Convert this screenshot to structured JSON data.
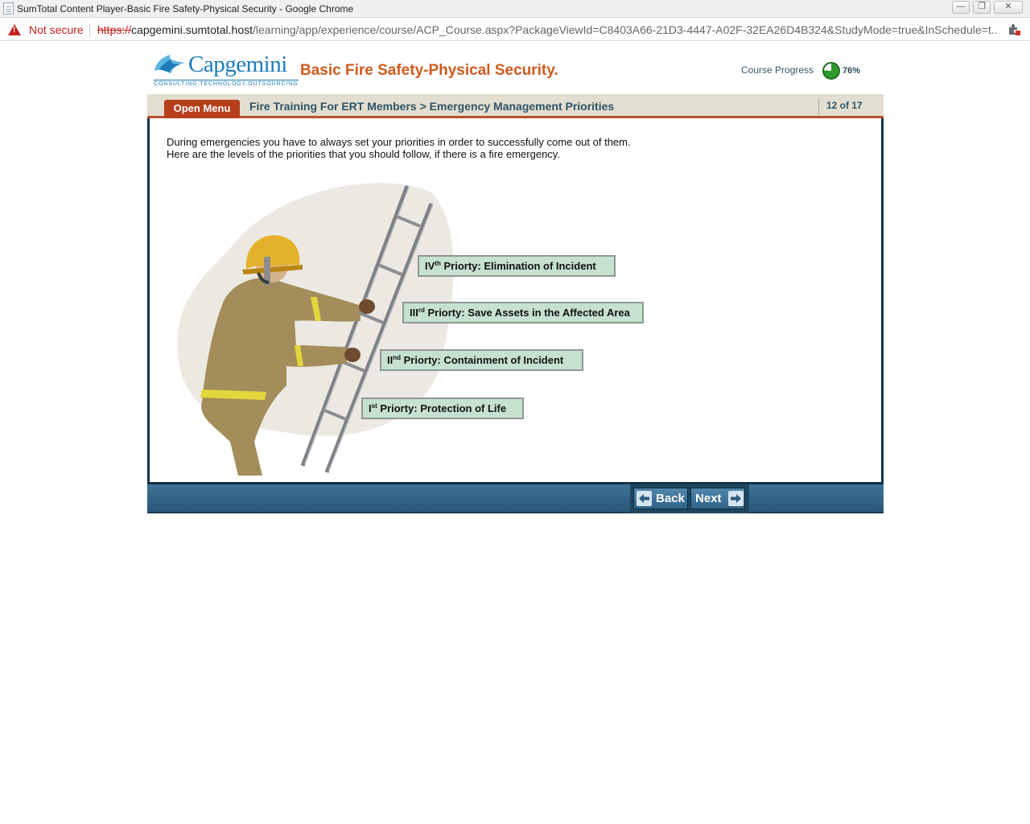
{
  "browser": {
    "window_title": "SumTotal Content Player-Basic Fire Safety-Physical Security - Google Chrome",
    "security_label": "Not secure",
    "url_scheme": "https://",
    "url_host": "capgemini.sumtotal.host",
    "url_path": "/learning/app/experience/course/ACP_Course.aspx?PackageViewId=C8403A66-21D3-4447-A02F-32EA26D4B324&StudyMode=true&InSchedule=t..."
  },
  "header": {
    "logo_text": "Capgemini",
    "logo_tagline": "CONSULTING.TECHNOLOGY.OUTSOURCING",
    "course_title": "Basic Fire Safety-Physical Security.",
    "progress_label": "Course Progress",
    "progress_value": "76%",
    "progress_fraction": 0.76
  },
  "navbar": {
    "open_menu_label": "Open Menu",
    "breadcrumb": "Fire Training For ERT Members > Emergency Management Priorities",
    "page_count": "12 of 17"
  },
  "content": {
    "intro": "During emergencies you have to always set your priorities in order to successfully come out of them. Here are the levels of the priorities that you should follow, if there is a fire emergency.",
    "priorities": [
      {
        "numeral": "IV",
        "suffix": "th",
        "text": "Priorty: Elimination of Incident"
      },
      {
        "numeral": "III",
        "suffix": "rd",
        "text": "Priorty: Save Assets in the Affected Area"
      },
      {
        "numeral": "II",
        "suffix": "nd",
        "text": "Priorty: Containment of Incident"
      },
      {
        "numeral": "I",
        "suffix": "st",
        "text": "Priorty: Protection of Life"
      }
    ]
  },
  "footer": {
    "back_label": "Back",
    "next_label": "Next"
  },
  "colors": {
    "accent_orange": "#d05a1e",
    "menu_red": "#b83f1c",
    "frame_navy": "#123247",
    "priority_fill": "#c7e1cf",
    "progress_green": "#2e9a2e"
  },
  "icons": [
    "warning-icon",
    "extension-icon",
    "minimize-icon",
    "restore-icon",
    "close-icon",
    "progress-pie-icon",
    "back-arrow-icon",
    "next-arrow-icon"
  ]
}
